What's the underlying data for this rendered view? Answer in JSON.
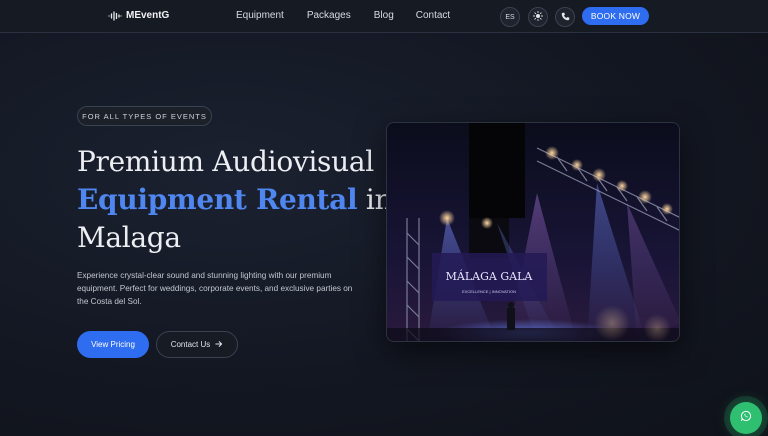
{
  "brand": {
    "name": "MEventG",
    "icon": "sound-wave-icon"
  },
  "nav": {
    "items": [
      {
        "label": "Equipment"
      },
      {
        "label": "Packages"
      },
      {
        "label": "Blog"
      },
      {
        "label": "Contact"
      }
    ]
  },
  "header": {
    "language": "ES",
    "theme_icon": "sun-icon",
    "phone_icon": "phone-icon",
    "book_label": "BOOK NOW"
  },
  "hero": {
    "badge": "FOR ALL TYPES OF EVENTS",
    "title_line1": "Premium Audiovisual",
    "title_accent": "Equipment Rental",
    "title_in": " in",
    "title_line3": "Malaga",
    "description": "Experience crystal-clear sound and stunning lighting with our premium equipment. Perfect for weddings, corporate events, and exclusive parties on the Costa del Sol.",
    "primary_cta": "View Pricing",
    "secondary_cta": "Contact Us",
    "image": {
      "screen_title": "MÁLAGA GALA",
      "screen_subtitle": "EXCELLENCE | INNOVATION"
    }
  },
  "colors": {
    "accent": "#2f6df0",
    "headline_accent": "#4f86ef",
    "whatsapp": "#2fbf71"
  },
  "floating": {
    "whatsapp_icon": "whatsapp-icon"
  }
}
